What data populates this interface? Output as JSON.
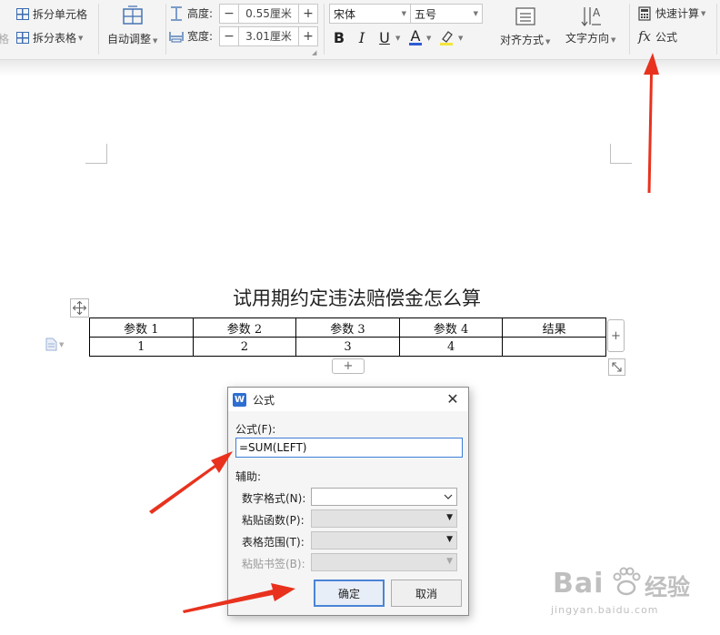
{
  "ribbon": {
    "split_cells": "拆分单元格",
    "split_table": "拆分表格",
    "left_cut_label": "格",
    "auto_fit": "自动调整",
    "height_label": "高度:",
    "height_value": "0.55厘米",
    "width_label": "宽度:",
    "width_value": "3.01厘米",
    "font_name": "宋体",
    "font_size": "五号",
    "bold": "B",
    "italic": "I",
    "underline": "U",
    "font_color": "A",
    "align": "对齐方式",
    "text_direction": "文字方向",
    "quick_calc": "快速计算",
    "formula_icon": "fx",
    "formula": "公式",
    "font_color_hex": "#2f5bd6",
    "highlight_hex": "#f3e63a"
  },
  "document": {
    "title": "试用期约定违法赔偿金怎么算",
    "table": {
      "headers": [
        "参数 1",
        "参数 2",
        "参数 3",
        "参数 4",
        "结果"
      ],
      "row": [
        "1",
        "2",
        "3",
        "4",
        ""
      ]
    },
    "add_col": "+",
    "add_row": "+",
    "move_icon": "move-cross-icon",
    "resize_icon": "resize-diagonal-icon"
  },
  "dialog": {
    "title": "公式",
    "app_icon": "W",
    "close": "✕",
    "formula_label": "公式(F):",
    "formula_value": "=SUM(LEFT)",
    "assist_label": "辅助:",
    "number_format_label": "数字格式(N):",
    "paste_function_label": "粘贴函数(P):",
    "table_range_label": "表格范围(T):",
    "paste_bookmark_label": "粘贴书签(B):",
    "ok": "确定",
    "cancel": "取消"
  },
  "annotations": {
    "arrow_color": "#e8321e"
  },
  "watermark": {
    "brand_left": "Bai",
    "brand_right": "经验",
    "url": "jingyan.baidu.com"
  }
}
